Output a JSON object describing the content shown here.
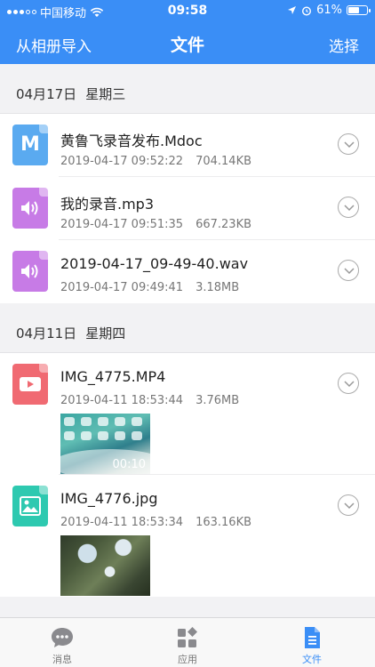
{
  "status_bar": {
    "carrier": "中国移动",
    "time": "09:58",
    "battery": "61%",
    "battery_level": 0.61
  },
  "nav": {
    "left_label": "从相册导入",
    "title": "文件",
    "right_label": "选择"
  },
  "sections": [
    {
      "date": "04月17日",
      "weekday": "星期三",
      "files": [
        {
          "name": "黄鲁飞录音发布.Mdoc",
          "time": "2019-04-17 09:52:22",
          "size": "704.14KB",
          "type_icon": "mdoc-icon",
          "icon_letter": "M",
          "color": "#5aaaf0"
        },
        {
          "name": "我的录音.mp3",
          "time": "2019-04-17 09:51:35",
          "size": "667.23KB",
          "type_icon": "audio-file-icon",
          "color": "#c77be6"
        },
        {
          "name": "2019-04-17_09-49-40.wav",
          "time": "2019-04-17 09:49:41",
          "size": "3.18MB",
          "type_icon": "audio-file-icon",
          "color": "#c77be6"
        }
      ]
    },
    {
      "date": "04月11日",
      "weekday": "星期四",
      "files": [
        {
          "name": "IMG_4775.MP4",
          "time": "2019-04-11 18:53:44",
          "size": "3.76MB",
          "type_icon": "video-file-icon",
          "color": "#f06a72",
          "thumb_duration": "00:10"
        },
        {
          "name": "IMG_4776.jpg",
          "time": "2019-04-11 18:53:34",
          "size": "163.16KB",
          "type_icon": "image-file-icon",
          "color": "#2ec9b0"
        }
      ]
    }
  ],
  "tabbar": {
    "tabs": [
      {
        "label": "消息",
        "icon": "chat-bubble-icon",
        "active": false
      },
      {
        "label": "应用",
        "icon": "apps-grid-icon",
        "active": false
      },
      {
        "label": "文件",
        "icon": "document-icon",
        "active": true
      }
    ],
    "active_color": "#3a8ef6"
  }
}
